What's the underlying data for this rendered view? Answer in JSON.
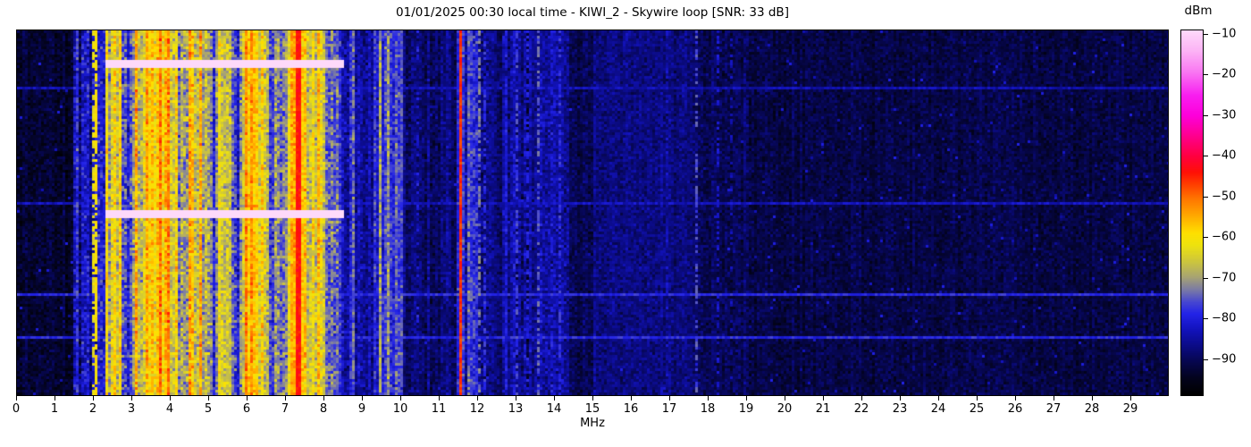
{
  "chart_data": {
    "type": "heatmap",
    "subtype": "rf-spectrogram-waterfall",
    "title": "01/01/2025 00:30 local time - KIWI_2 - Skywire loop [SNR: 33 dB]",
    "xlabel": "MHz",
    "ylabel": "",
    "x_range_mhz": [
      0,
      30
    ],
    "x_ticks": [
      0,
      1,
      2,
      3,
      4,
      5,
      6,
      7,
      8,
      9,
      10,
      11,
      12,
      13,
      14,
      15,
      16,
      17,
      18,
      19,
      20,
      21,
      22,
      23,
      24,
      25,
      26,
      27,
      28,
      29
    ],
    "y_axis_note": "time axis, no ticks shown",
    "colorbar_label": "dBm",
    "colorbar_ticks": [
      -10,
      -20,
      -30,
      -40,
      -50,
      -60,
      -70,
      -80,
      -90
    ],
    "value_range_dbm": [
      -99,
      -9
    ],
    "colormap_stops": [
      [
        -99,
        "#000000"
      ],
      [
        -95,
        "#03031c"
      ],
      [
        -91,
        "#06064c"
      ],
      [
        -87,
        "#0b0b85"
      ],
      [
        -83,
        "#1212bb"
      ],
      [
        -79,
        "#2323e8"
      ],
      [
        -76,
        "#4848d0"
      ],
      [
        -73,
        "#7b7ba4"
      ],
      [
        -70,
        "#a6a274"
      ],
      [
        -66,
        "#cec63c"
      ],
      [
        -62,
        "#eee30e"
      ],
      [
        -59,
        "#ffdf00"
      ],
      [
        -55,
        "#ffac00"
      ],
      [
        -51,
        "#ff7c00"
      ],
      [
        -47,
        "#ff3e00"
      ],
      [
        -44,
        "#ff1006"
      ],
      [
        -40,
        "#ff0040"
      ],
      [
        -35,
        "#fe008e"
      ],
      [
        -30,
        "#fd00da"
      ],
      [
        -25,
        "#f81ef0"
      ],
      [
        -19,
        "#f97af2"
      ],
      [
        -14,
        "#fcb3f5"
      ],
      [
        -9,
        "#fed9fa"
      ]
    ],
    "noise_floor_bands": [
      {
        "f0": 0.0,
        "f1": 1.5,
        "mean_dbm": -93.5,
        "col_spread_db": 1.5,
        "cell_var_db": 4.5
      },
      {
        "f0": 1.5,
        "f1": 2.3,
        "mean_dbm": -84,
        "col_spread_db": 6,
        "cell_var_db": 8
      },
      {
        "f0": 2.3,
        "f1": 2.75,
        "mean_dbm": -67,
        "col_spread_db": 7,
        "cell_var_db": 8
      },
      {
        "f0": 2.75,
        "f1": 3.05,
        "mean_dbm": -77,
        "col_spread_db": 6,
        "cell_var_db": 8
      },
      {
        "f0": 3.05,
        "f1": 4.15,
        "mean_dbm": -60,
        "col_spread_db": 9,
        "cell_var_db": 8
      },
      {
        "f0": 4.15,
        "f1": 4.45,
        "mean_dbm": -67,
        "col_spread_db": 8,
        "cell_var_db": 9
      },
      {
        "f0": 4.45,
        "f1": 4.8,
        "mean_dbm": -62,
        "col_spread_db": 8,
        "cell_var_db": 8
      },
      {
        "f0": 4.8,
        "f1": 5.25,
        "mean_dbm": -71,
        "col_spread_db": 8,
        "cell_var_db": 8
      },
      {
        "f0": 5.25,
        "f1": 5.55,
        "mean_dbm": -66,
        "col_spread_db": 7,
        "cell_var_db": 8
      },
      {
        "f0": 5.55,
        "f1": 5.85,
        "mean_dbm": -73,
        "col_spread_db": 7,
        "cell_var_db": 8
      },
      {
        "f0": 5.85,
        "f1": 6.25,
        "mean_dbm": -58,
        "col_spread_db": 8,
        "cell_var_db": 7
      },
      {
        "f0": 6.25,
        "f1": 7.1,
        "mean_dbm": -68,
        "col_spread_db": 9,
        "cell_var_db": 8
      },
      {
        "f0": 7.1,
        "f1": 7.45,
        "mean_dbm": -52,
        "col_spread_db": 6,
        "cell_var_db": 6
      },
      {
        "f0": 7.45,
        "f1": 7.95,
        "mean_dbm": -63,
        "col_spread_db": 7,
        "cell_var_db": 8
      },
      {
        "f0": 7.95,
        "f1": 8.35,
        "mean_dbm": -69,
        "col_spread_db": 8,
        "cell_var_db": 8
      },
      {
        "f0": 8.35,
        "f1": 8.8,
        "mean_dbm": -79,
        "col_spread_db": 7,
        "cell_var_db": 7
      },
      {
        "f0": 8.8,
        "f1": 9.3,
        "mean_dbm": -85,
        "col_spread_db": 4,
        "cell_var_db": 6
      },
      {
        "f0": 9.3,
        "f1": 10.05,
        "mean_dbm": -77,
        "col_spread_db": 7,
        "cell_var_db": 7
      },
      {
        "f0": 10.05,
        "f1": 11.45,
        "mean_dbm": -89,
        "col_spread_db": 2.5,
        "cell_var_db": 5
      },
      {
        "f0": 11.45,
        "f1": 11.65,
        "mean_dbm": -80,
        "col_spread_db": 4,
        "cell_var_db": 6
      },
      {
        "f0": 11.65,
        "f1": 12.3,
        "mean_dbm": -81,
        "col_spread_db": 6,
        "cell_var_db": 7
      },
      {
        "f0": 12.3,
        "f1": 12.65,
        "mean_dbm": -88,
        "col_spread_db": 2,
        "cell_var_db": 5
      },
      {
        "f0": 12.65,
        "f1": 14.35,
        "mean_dbm": -86,
        "col_spread_db": 4,
        "cell_var_db": 6
      },
      {
        "f0": 14.35,
        "f1": 15.0,
        "mean_dbm": -91,
        "col_spread_db": 1.5,
        "cell_var_db": 4.5
      },
      {
        "f0": 15.0,
        "f1": 17.6,
        "mean_dbm": -87.5,
        "col_spread_db": 1.2,
        "cell_var_db": 4.5
      },
      {
        "f0": 17.6,
        "f1": 19.2,
        "mean_dbm": -90,
        "col_spread_db": 1.5,
        "cell_var_db": 4.5
      },
      {
        "f0": 19.2,
        "f1": 30.01,
        "mean_dbm": -91.5,
        "col_spread_db": 1.2,
        "cell_var_db": 4
      }
    ],
    "spectral_lines": [
      {
        "freq_mhz": 1.97,
        "width_mhz": 0.05,
        "level_dbm": -63,
        "occupancy": 0.5
      },
      {
        "freq_mhz": 2.07,
        "width_mhz": 0.04,
        "level_dbm": -60,
        "occupancy": 0.85
      },
      {
        "freq_mhz": 7.33,
        "width_mhz": 0.13,
        "level_dbm": -44,
        "occupancy": 1.0
      },
      {
        "freq_mhz": 11.55,
        "width_mhz": 0.09,
        "level_dbm": -46,
        "occupancy": 1.0
      },
      {
        "freq_mhz": 10.02,
        "width_mhz": 0.04,
        "level_dbm": -75,
        "occupancy": 0.35
      },
      {
        "freq_mhz": 10.45,
        "width_mhz": 0.04,
        "level_dbm": -80,
        "occupancy": 0.3
      },
      {
        "freq_mhz": 11.9,
        "width_mhz": 0.05,
        "level_dbm": -76,
        "occupancy": 0.5
      },
      {
        "freq_mhz": 12.05,
        "width_mhz": 0.05,
        "level_dbm": -73,
        "occupancy": 0.5
      },
      {
        "freq_mhz": 12.2,
        "width_mhz": 0.04,
        "level_dbm": -78,
        "occupancy": 0.4
      },
      {
        "freq_mhz": 12.75,
        "width_mhz": 0.04,
        "level_dbm": -80,
        "occupancy": 0.5
      },
      {
        "freq_mhz": 13.0,
        "width_mhz": 0.05,
        "level_dbm": -77,
        "occupancy": 0.6
      },
      {
        "freq_mhz": 13.3,
        "width_mhz": 0.04,
        "level_dbm": -80,
        "occupancy": 0.5
      },
      {
        "freq_mhz": 13.55,
        "width_mhz": 0.05,
        "level_dbm": -75,
        "occupancy": 0.5
      },
      {
        "freq_mhz": 13.9,
        "width_mhz": 0.04,
        "level_dbm": -80,
        "occupancy": 0.4
      },
      {
        "freq_mhz": 14.15,
        "width_mhz": 0.04,
        "level_dbm": -78,
        "occupancy": 0.45
      },
      {
        "freq_mhz": 16.95,
        "width_mhz": 0.04,
        "level_dbm": -83,
        "occupancy": 0.5
      },
      {
        "freq_mhz": 17.7,
        "width_mhz": 0.05,
        "level_dbm": -76,
        "occupancy": 0.5
      },
      {
        "freq_mhz": 18.25,
        "width_mhz": 0.04,
        "level_dbm": -82,
        "occupancy": 0.4
      },
      {
        "freq_mhz": 18.6,
        "width_mhz": 0.03,
        "level_dbm": -84,
        "occupancy": 0.3
      }
    ],
    "broadband_impulse_rows": [
      {
        "time_frac": 0.151,
        "level_dbm": -84
      },
      {
        "time_frac": 0.468,
        "level_dbm": -83
      },
      {
        "time_frac": 0.722,
        "level_dbm": -79
      },
      {
        "time_frac": 0.837,
        "level_dbm": -79
      }
    ],
    "busy_band_rows": [
      {
        "time_frac": 0.085,
        "boost_db": 4
      },
      {
        "time_frac": 0.5,
        "boost_db": 4.5
      }
    ],
    "busy_band_range_mhz": [
      2.3,
      8.5
    ],
    "render_seed": 1234
  },
  "colors": {
    "background": "#ffffff",
    "text": "#000000",
    "axis": "#000000"
  }
}
